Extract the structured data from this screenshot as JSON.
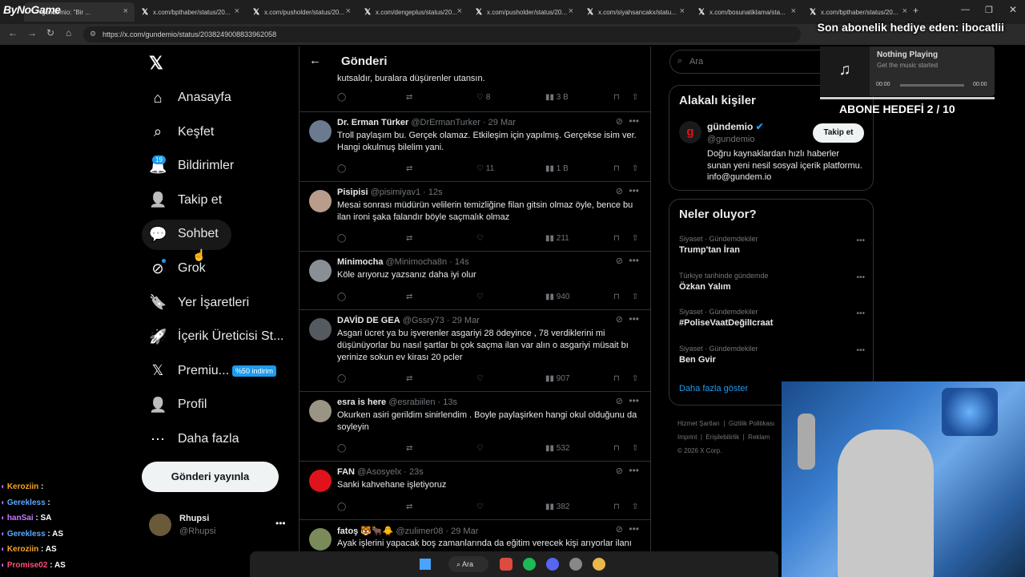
{
  "browser": {
    "tabs": [
      {
        "label": "gundemio: \"Bir ...",
        "active": true
      },
      {
        "label": "x.com/bpthaber/status/20..."
      },
      {
        "label": "x.com/pusholder/status/20..."
      },
      {
        "label": "x.com/dengeplus/status/20..."
      },
      {
        "label": "x.com/pusholder/status/20..."
      },
      {
        "label": "x.com/siyahsancakx/statu..."
      },
      {
        "label": "x.com/bosunatiklama/sta..."
      },
      {
        "label": "x.com/bpthaber/status/20..."
      }
    ],
    "url": "https://x.com/gundemio/status/2038249008833962058",
    "search_placeholder": "Ara"
  },
  "stream": {
    "logo": "ByNoGame",
    "top_banner": "Son abonelik hediye eden: ibocatlii",
    "music_title": "Nothing Playing",
    "music_sub": "Get the music started",
    "music_time_left": "00:00",
    "music_time_right": "00:00",
    "abone_goal": "ABONE HEDEFİ 2 / 10",
    "chat": [
      {
        "user": "Keroziin",
        "msg": "",
        "color": "#f5a623"
      },
      {
        "user": "Gerekless",
        "msg": "",
        "color": "#5aa9ff"
      },
      {
        "user": "hanSai",
        "msg": "SA",
        "color": "#c47bff"
      },
      {
        "user": "Gerekless",
        "msg": "AS",
        "color": "#5aa9ff"
      },
      {
        "user": "Keroziin",
        "msg": "AS",
        "color": "#f5a623"
      },
      {
        "user": "Promise02",
        "msg": "AS",
        "color": "#ff4f7b"
      }
    ]
  },
  "sidebar": {
    "items": [
      {
        "label": "Anasayfa",
        "icon": "home-icon"
      },
      {
        "label": "Keşfet",
        "icon": "search-icon"
      },
      {
        "label": "Bildirimler",
        "icon": "bell-icon",
        "badge": "19"
      },
      {
        "label": "Takip et",
        "icon": "person-add-icon"
      },
      {
        "label": "Sohbet",
        "icon": "chat-icon"
      },
      {
        "label": "Grok",
        "icon": "grok-icon"
      },
      {
        "label": "Yer İşaretleri",
        "icon": "bookmark-icon"
      },
      {
        "label": "İçerik Üreticisi St...",
        "icon": "rocket-icon"
      },
      {
        "label": "Premiu...",
        "icon": "x-icon",
        "badge": "%50 indirim"
      },
      {
        "label": "Profil",
        "icon": "person-icon"
      },
      {
        "label": "Daha fazla",
        "icon": "more-circle-icon"
      }
    ],
    "post_button": "Gönderi yayınla",
    "profile_name": "Rhupsi",
    "profile_handle": "@Rhupsi"
  },
  "feed": {
    "title": "Gönderi",
    "partial_text": "kutsaldır, buralara düşürenler utansın.",
    "partial_actions": {
      "likes": "8",
      "views": "3 B"
    },
    "tweets": [
      {
        "name": "Dr. Erman Türker",
        "handle": "@DrErmanTurker",
        "time": "29 Mar",
        "text": "Troll paylaşım bu. Gerçek olamaz. Etkileşim için yapılmış. Gerçekse isim ver. Hangi okulmuş bilelim yani.",
        "likes": "11",
        "views": "1 B",
        "avatar_color": "#6b7a8f"
      },
      {
        "name": "Pisipisi",
        "handle": "@pisimiyav1",
        "time": "12s",
        "text": "Mesai sonrası müdürün velilerin temizliğine filan gitsin olmaz öyle,  bence bu ilan ironi şaka falandır böyle saçmalık olmaz",
        "likes": "",
        "views": "211",
        "avatar_color": "#b89c8c"
      },
      {
        "name": "Minimocha",
        "handle": "@Minimocha8n",
        "time": "14s",
        "text": "Köle arıyoruz yazsanız daha iyi olur",
        "likes": "",
        "views": "940",
        "avatar_color": "#8a8f96"
      },
      {
        "name": "DAVİD DE GEA",
        "handle": "@Gssry73",
        "time": "29 Mar",
        "text": "Asgari ücret ya bu işverenler asgariyi 28 ödeyince , 78 verdiklerini mi düşünüyorlar bu nasıl şartlar bı çok saçma ilan var alın o asgariyi müsait bı yerinize sokun ev kirası 20 pcler",
        "likes": "",
        "views": "907",
        "avatar_color": "#555a60"
      },
      {
        "name": "esra is here",
        "handle": "@esrabiilen",
        "time": "13s",
        "text": "Okurken asiri gerildim sinirlendim . Boyle paylaşirken hangi okul olduğunu da soyleyin",
        "likes": "",
        "views": "532",
        "avatar_color": "#9a9484"
      },
      {
        "name": "FAN",
        "handle": "@Asosyelx",
        "time": "23s",
        "text": "Sanki kahvehane işletiyoruz",
        "likes": "",
        "views": "382",
        "avatar_color": "#e0121b"
      },
      {
        "name": "fatoş 🐯🐂🐥",
        "handle": "@zulimer08",
        "time": "29 Mar",
        "text": "Ayak işlerini yapacak boş zamanlarında da eğitim verecek kişi arıyorlar ilanı",
        "likes": "",
        "views": "",
        "avatar_color": "#7a8a5a"
      }
    ]
  },
  "right": {
    "search_placeholder": "Ara",
    "related_title": "Alakalı kişiler",
    "person_name": "gündemio",
    "person_handle": "@gundemio",
    "person_bio": "Doğru kaynaklardan hızlı haberler sunan yeni nesil sosyal içerik platformu. info@gundem.io",
    "follow_button": "Takip et",
    "trends_title": "Neler oluyor?",
    "trends": [
      {
        "cat": "Siyaset · Gündemdekiler",
        "name": "Trump'tan İran"
      },
      {
        "cat": "Türkiye tarihinde gündemde",
        "name": "Özkan Yalım"
      },
      {
        "cat": "Siyaset · Gündemdekiler",
        "name": "#PoliseVaatDeğilIcraat"
      },
      {
        "cat": "Siyaset · Gündemdekiler",
        "name": "Ben Gvir"
      }
    ],
    "show_more": "Daha fazla göster",
    "footer": [
      "Hizmet Şartları",
      "Gizlilik Politikası",
      "Imprint",
      "Erişilebilirlik",
      "Reklam",
      "© 2026 X Corp."
    ]
  },
  "taskbar": {
    "search_label": "Ara"
  }
}
